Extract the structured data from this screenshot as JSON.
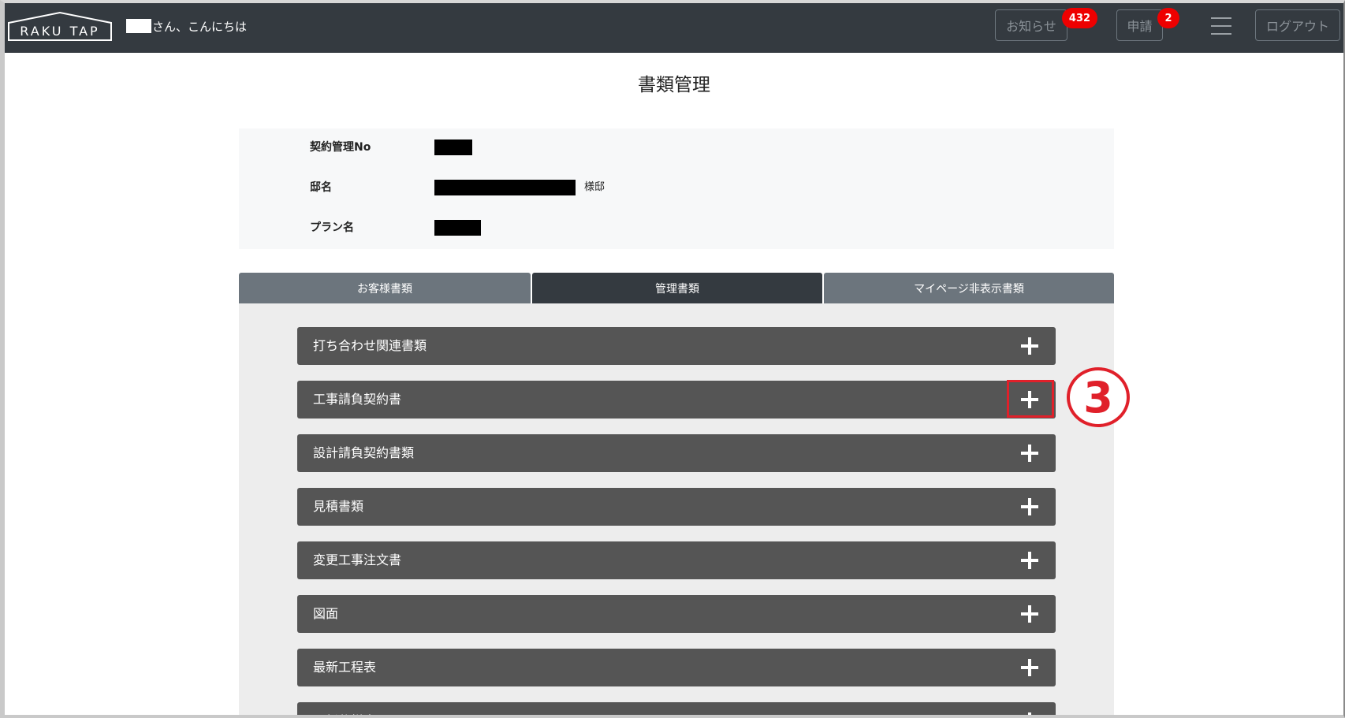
{
  "navbar": {
    "logo_text": "RAKU TAP",
    "greeting": "さん、こんにちは",
    "news_label": "お知らせ",
    "news_count": "432",
    "requests_label": "申請",
    "requests_count": "2",
    "menu_icon": "hamburger-icon",
    "logout_label": "ログアウト"
  },
  "page": {
    "title": "書類管理"
  },
  "info": {
    "contract_no_label": "契約管理No",
    "residence_label": "邸名",
    "residence_suffix": "様邸",
    "plan_label": "プラン名"
  },
  "tabs": [
    {
      "label": "お客様書類",
      "active": false
    },
    {
      "label": "管理書類",
      "active": true
    },
    {
      "label": "マイページ非表示書類",
      "active": false
    }
  ],
  "accordion": [
    {
      "label": "打ち合わせ関連書類",
      "icon": "plus-icon"
    },
    {
      "label": "工事請負契約書",
      "icon": "plus-icon"
    },
    {
      "label": "設計請負契約書類",
      "icon": "plus-icon"
    },
    {
      "label": "見積書類",
      "icon": "plus-icon"
    },
    {
      "label": "変更工事注文書",
      "icon": "plus-icon"
    },
    {
      "label": "図面",
      "icon": "plus-icon"
    },
    {
      "label": "最新工程表",
      "icon": "plus-icon"
    },
    {
      "label": "最新仕様書",
      "icon": "plus-icon"
    }
  ],
  "annotation": {
    "step_label": "3",
    "color": "#e0202a"
  },
  "colors": {
    "navbar": "#343a40",
    "tab_inactive": "#6c757d",
    "accordion": "#555555",
    "badge": "#ee0000"
  }
}
